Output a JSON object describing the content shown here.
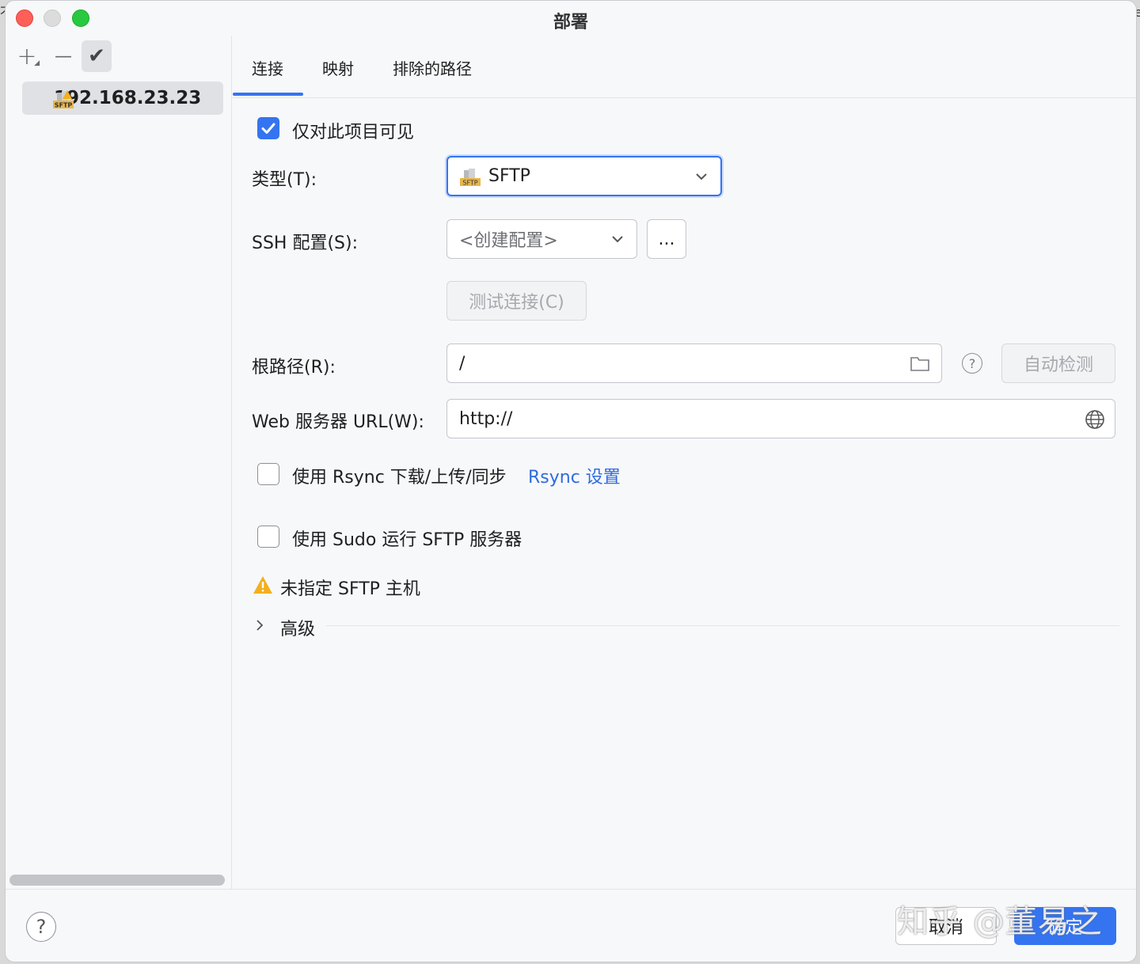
{
  "window": {
    "title": "部署"
  },
  "sidebar": {
    "toolbar": {
      "add": "+",
      "remove": "—",
      "apply": "✔"
    },
    "servers": [
      {
        "label": "192.168.23.23",
        "icon": "sftp-icon"
      }
    ]
  },
  "tabs": [
    {
      "label": "连接",
      "active": true
    },
    {
      "label": "映射",
      "active": false
    },
    {
      "label": "排除的路径",
      "active": false
    }
  ],
  "connection": {
    "visible_only_this_project": {
      "label": "仅对此项目可见",
      "checked": true
    },
    "type": {
      "label": "类型(T):",
      "value": "SFTP"
    },
    "ssh_config": {
      "label": "SSH 配置(S):",
      "value": "<创建配置>",
      "more_button": "..."
    },
    "test_connection_button": "测试连接(C)",
    "root_path": {
      "label": "根路径(R):",
      "value": "/",
      "autodetect_button": "自动检测"
    },
    "web_server_url": {
      "label": "Web 服务器 URL(W):",
      "value": "http://"
    },
    "use_rsync": {
      "label": "使用 Rsync 下载/上传/同步",
      "checked": false,
      "link": "Rsync 设置"
    },
    "use_sudo": {
      "label": "使用 Sudo 运行 SFTP 服务器",
      "checked": false
    },
    "warning": "未指定 SFTP 主机",
    "advanced": "高级"
  },
  "footer": {
    "help": "?",
    "cancel": "取消",
    "ok": "确定",
    "watermark": "知乎 @董易之"
  },
  "colors": {
    "accent": "#3574f0",
    "link": "#2f6be0",
    "warning": "#f2b01e"
  }
}
